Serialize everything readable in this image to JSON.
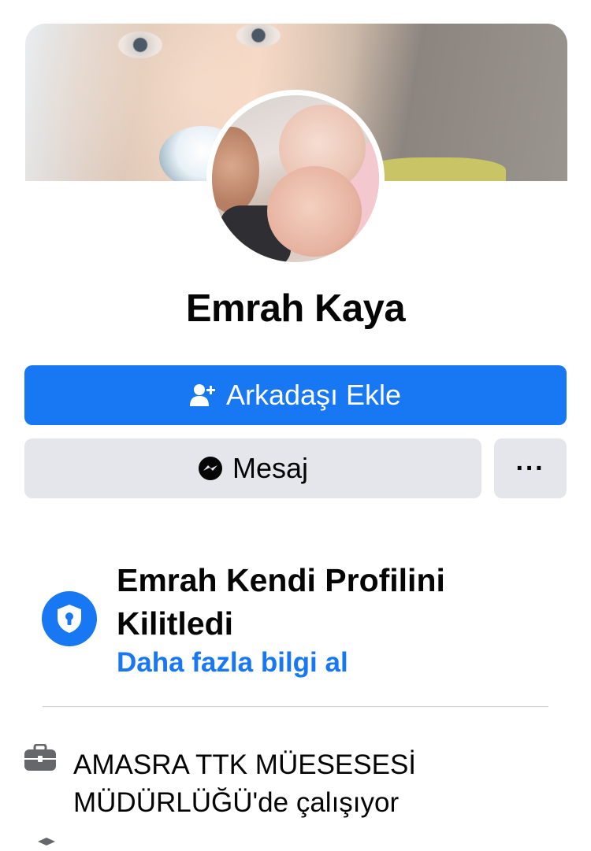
{
  "profile": {
    "name": "Emrah Kaya"
  },
  "actions": {
    "add_friend_label": "Arkadaşı Ekle",
    "message_label": "Mesaj",
    "more_label": "···"
  },
  "lock_notice": {
    "title": "Emrah Kendi Profilini Kilitledi",
    "link": "Daha fazla bilgi al"
  },
  "intro": {
    "work_line1": "AMASRA TTK MÜESESESİ",
    "work_line2": "MÜDÜRLÜĞÜ'de çalışıyor"
  },
  "icons": {
    "add_friend": "person-plus-icon",
    "message": "messenger-icon",
    "lock": "shield-lock-icon",
    "work": "briefcase-icon"
  },
  "colors": {
    "accent": "#1877f2",
    "secondary_button": "#e4e6eb",
    "text": "#050505"
  }
}
